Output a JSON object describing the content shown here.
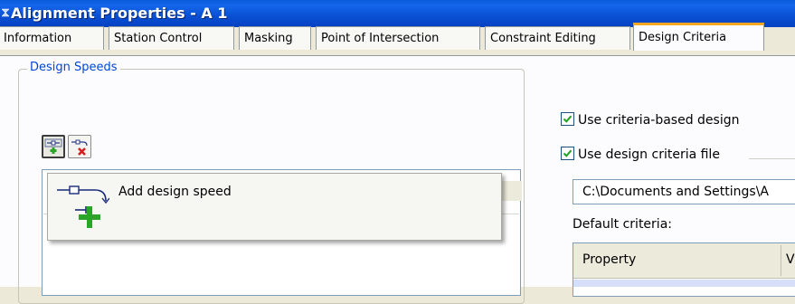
{
  "window": {
    "title": "Alignment Properties - A 1"
  },
  "tabs": [
    {
      "label": "Information"
    },
    {
      "label": "Station Control"
    },
    {
      "label": "Masking"
    },
    {
      "label": "Point of Intersection"
    },
    {
      "label": "Constraint Editing"
    },
    {
      "label": "Design Criteria",
      "active": true
    }
  ],
  "design_speeds": {
    "group_title": "Design Speeds",
    "add_button_icon": "add-design-speed-icon",
    "delete_button_icon": "delete-design-speed-icon",
    "popup_label": "Add design speed"
  },
  "criteria": {
    "use_criteria_label": "Use criteria-based design",
    "use_criteria_checked": true,
    "use_file_label": "Use design criteria file",
    "use_file_checked": true,
    "file_path": "C:\\Documents and Settings\\A",
    "default_criteria_label": "Default criteria:",
    "grid_col_property": "Property",
    "grid_col_value": "V"
  },
  "colors": {
    "title_bar": "#0a4fd3",
    "active_tab_accent": "#f5a623",
    "group_title": "#0046d5",
    "checkmark": "#21a121",
    "add_plus": "#2aa52a",
    "delete_x": "#d22020"
  }
}
